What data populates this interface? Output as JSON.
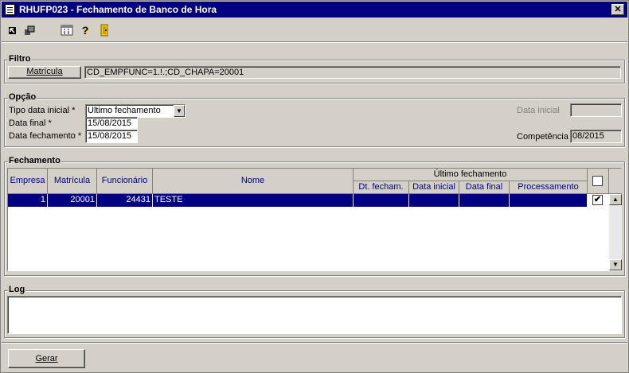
{
  "window": {
    "title": "RHUFP023 - Fechamento de Banco de Hora",
    "close_glyph": "✕"
  },
  "toolbar": {
    "icons": [
      "back-icon",
      "copy-icon",
      "calculator-icon",
      "help-icon",
      "exit-door-icon"
    ],
    "help_glyph": "?"
  },
  "filtro": {
    "label": "Filtro",
    "matricula_button": "Matrícula",
    "filter_value": "CD_EMPFUNC=1.!.;CD_CHAPA=20001"
  },
  "opcao": {
    "label": "Opção",
    "tipo_label": "Tipo data inicial *",
    "tipo_value": "Ultimo fechamento",
    "data_final_label": "Data final *",
    "data_final_value": "15/08/2015",
    "data_fechamento_label": "Data fechamento *",
    "data_fechamento_value": "15/08/2015",
    "data_inicial_label": "Data inicial",
    "data_inicial_value": "",
    "competencia_label": "Competência",
    "competencia_value": "08/2015"
  },
  "fechamento": {
    "label": "Fechamento",
    "headers": {
      "empresa": "Empresa",
      "matricula": "Matrícula",
      "funcionario": "Funcionário",
      "nome": "Nome",
      "ultimo": "Último fechamento",
      "dt_fecham": "Dt. fecham.",
      "data_inicial": "Data inicial",
      "data_final": "Data final",
      "processamento": "Processamento"
    },
    "rows": [
      {
        "empresa": "1",
        "matricula": "20001",
        "funcionario": "24431",
        "nome": "TESTE",
        "dt_fecham": "",
        "data_inicial": "",
        "data_final": "",
        "processamento": "",
        "checked": true
      }
    ],
    "check_glyph": "✔"
  },
  "log": {
    "label": "Log",
    "text": ""
  },
  "actions": {
    "gerar": "Gerar"
  }
}
